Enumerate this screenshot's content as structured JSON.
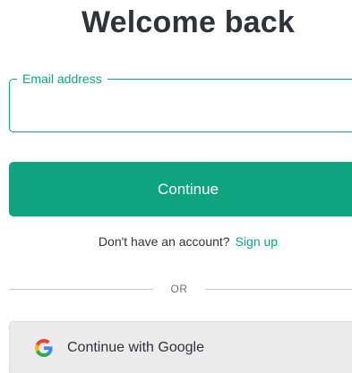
{
  "header": {
    "title": "Welcome back"
  },
  "form": {
    "email_label": "Email address",
    "email_value": "",
    "continue_label": "Continue"
  },
  "signup": {
    "prompt": "Don't have an account?",
    "link_label": "Sign up"
  },
  "divider": {
    "text": "OR"
  },
  "social": {
    "google_label": "Continue with Google",
    "google_icon": "google-g-icon"
  },
  "colors": {
    "accent": "#10a37f",
    "title_text": "#2d333a",
    "divider": "#c2c8d0",
    "google_button_bg": "#ebebeb"
  }
}
